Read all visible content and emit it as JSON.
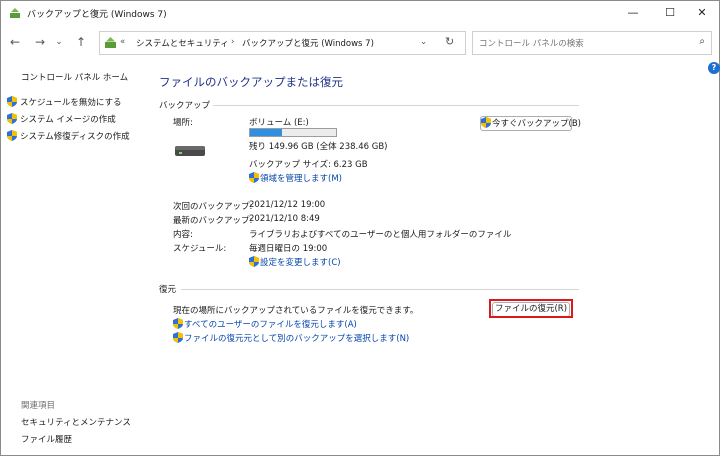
{
  "window": {
    "title": "バックアップと復元 (Windows 7)",
    "minimize_glyph": "—",
    "maximize_glyph": "☐",
    "close_glyph": "✕"
  },
  "nav": {
    "back_glyph": "←",
    "forward_glyph": "→",
    "dropdown_glyph": "⌄",
    "up_glyph": "↑",
    "crumb_chevrons": "«",
    "crumbs": [
      "システムとセキュリティ",
      "バックアップと復元 (Windows 7)"
    ],
    "sep": "›",
    "addr_dropdown": "⌄",
    "refresh_glyph": "↻",
    "search_placeholder": "コントロール パネルの検索",
    "search_icon": "⌕"
  },
  "left": {
    "home": "コントロール パネル ホーム",
    "tasks": [
      "スケジュールを無効にする",
      "システム イメージの作成",
      "システム修復ディスクの作成"
    ],
    "related_header": "関連項目",
    "related": [
      "セキュリティとメンテナンス",
      "ファイル履歴"
    ]
  },
  "main": {
    "title": "ファイルのバックアップまたは復元",
    "backup": {
      "section": "バックアップ",
      "location_label": "場所:",
      "volume": "ボリューム (E:)",
      "usage_fraction": 0.37,
      "remaining": "残り 149.96 GB (全体 238.46 GB)",
      "backup_size": "バックアップ サイズ: 6.23 GB",
      "manage_space": "領域を管理します(M)",
      "backup_now": "今すぐバックアップ(B)",
      "next_label": "次回のバックアップ:",
      "next_value": "2021/12/12 19:00",
      "last_label": "最新のバックアップ:",
      "last_value": "2021/12/10 8:49",
      "contents_label": "内容:",
      "contents_value": "ライブラリおよびすべてのユーザーのと個人用フォルダーのファイル",
      "schedule_label": "スケジュール:",
      "schedule_value": "毎週日曜日の 19:00",
      "change_settings": "設定を変更します(C)"
    },
    "restore": {
      "section": "復元",
      "desc": "現在の場所にバックアップされているファイルを復元できます。",
      "restore_files": "ファイルの復元(R)",
      "restore_all_users": "すべてのユーザーのファイルを復元します(A)",
      "select_other": "ファイルの復元元として別のバックアップを選択します(N)"
    },
    "help_glyph": "?"
  },
  "colors": {
    "accent": "#1e3287",
    "link": "#0645ad",
    "highlight": "#d9191c",
    "progress": "#2f8fe0"
  }
}
